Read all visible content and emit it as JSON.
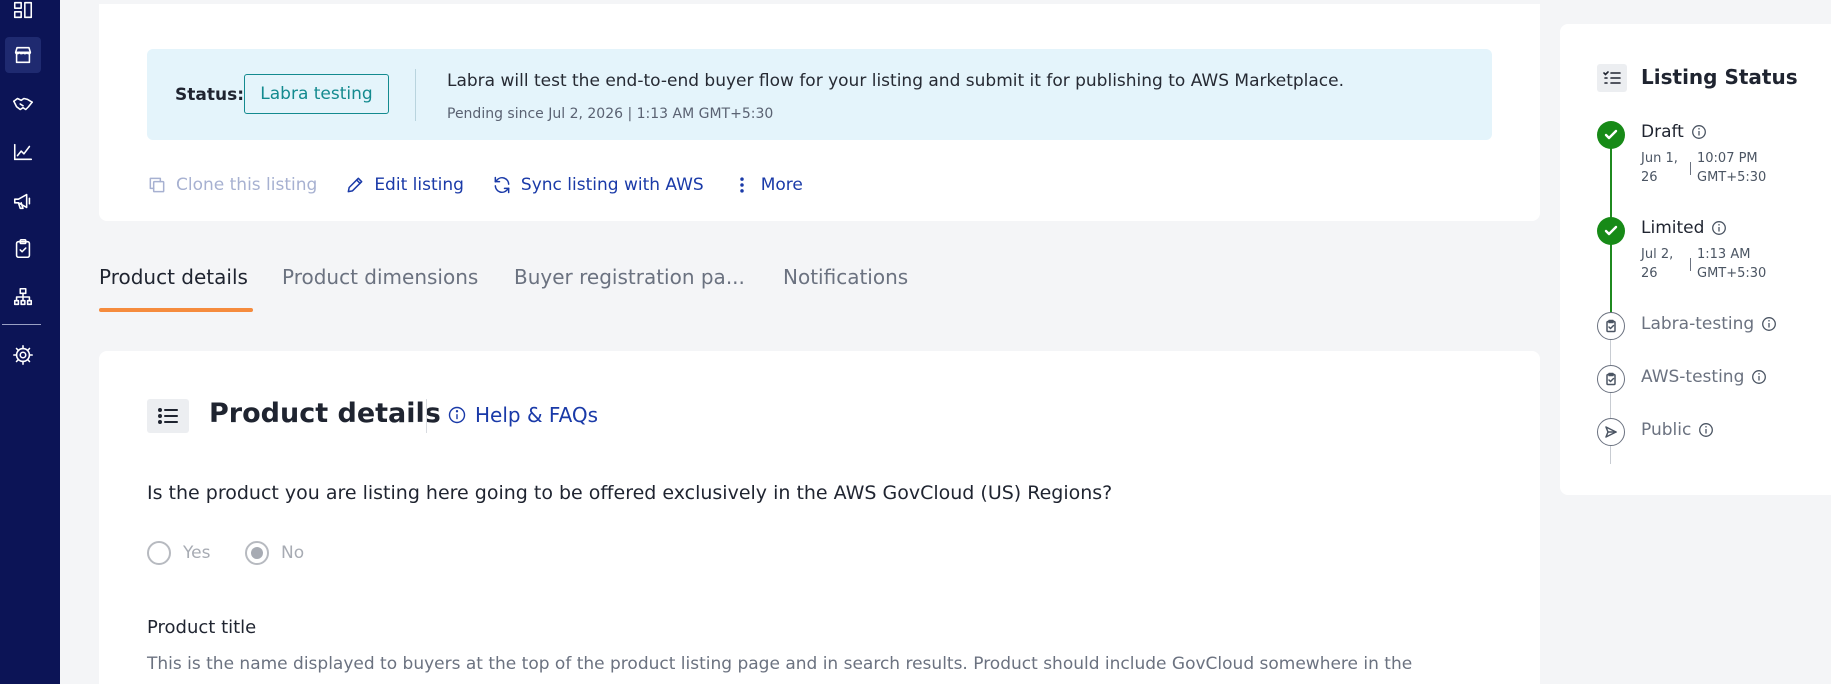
{
  "status_panel": {
    "label": "Status:",
    "value": "Labra testing",
    "message": "Labra will test the end-to-end buyer flow for your listing and submit it for publishing to AWS Marketplace.",
    "since": "Pending since Jul 2, 2026 | 1:13 AM GMT+5:30"
  },
  "actions": {
    "clone": "Clone this listing",
    "edit": "Edit listing",
    "sync": "Sync listing with AWS",
    "more": "More"
  },
  "tabs": {
    "product_details": "Product details",
    "product_dimensions": "Product dimensions",
    "buyer_registration": "Buyer registration pa...",
    "notifications": "Notifications"
  },
  "section": {
    "title": "Product details",
    "help": "Help & FAQs",
    "question": "Is the product you are listing here going to be offered exclusively in the AWS GovCloud (US) Regions?",
    "yes": "Yes",
    "no": "No",
    "selected_option": "No",
    "field_label": "Product title",
    "field_help": "This is the name displayed to buyers at the top of the product listing page and in search results. Product should include GovCloud somewhere in the"
  },
  "listing_status": {
    "title": "Listing Status",
    "draft": {
      "name": "Draft",
      "date_line1": "Jun 1,",
      "date_line2": "26",
      "time_line1": "10:07 PM",
      "time_line2": "GMT+5:30"
    },
    "limited": {
      "name": "Limited",
      "date_line1": "Jul 2,",
      "date_line2": "26",
      "time_line1": "1:13 AM",
      "time_line2": "GMT+5:30"
    },
    "labra_testing": {
      "name": "Labra-testing"
    },
    "aws_testing": {
      "name": "AWS-testing"
    },
    "public": {
      "name": "Public"
    }
  },
  "colors": {
    "sidebar": "#0c1456",
    "link": "#1a3aa8",
    "status_pill": "#138a8f",
    "tab_underline": "#f58b3d",
    "step_done": "#178a17"
  }
}
